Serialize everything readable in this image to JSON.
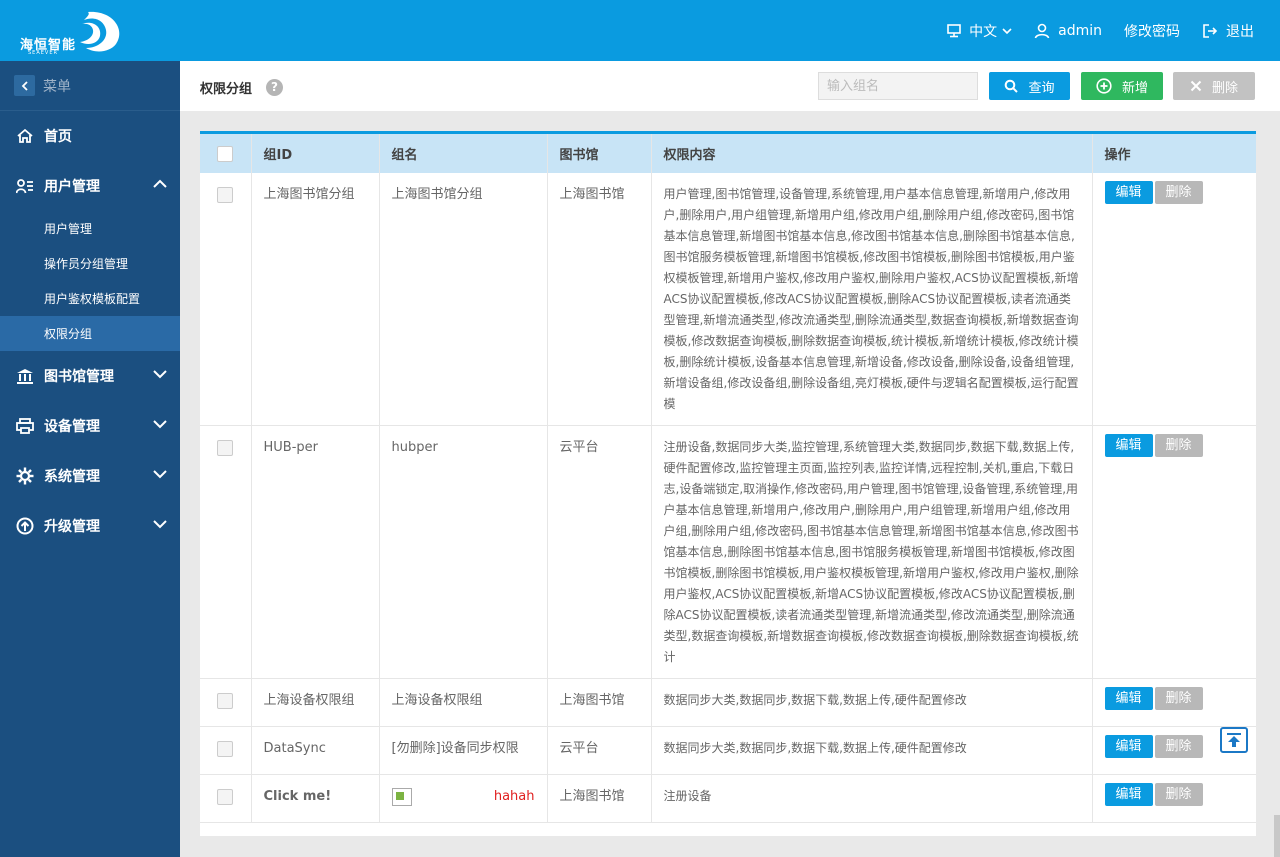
{
  "header": {
    "logo_text": "海恒智能",
    "logo_sub": "SEAEVER",
    "language": "中文",
    "username": "admin",
    "change_password": "修改密码",
    "logout": "退出"
  },
  "sidebar": {
    "menu_label": "菜单",
    "items": [
      {
        "label": "首页"
      },
      {
        "label": "用户管理"
      },
      {
        "label": "图书馆管理"
      },
      {
        "label": "设备管理"
      },
      {
        "label": "系统管理"
      },
      {
        "label": "升级管理"
      }
    ],
    "sub_items": [
      {
        "label": "用户管理"
      },
      {
        "label": "操作员分组管理"
      },
      {
        "label": "用户鉴权模板配置"
      },
      {
        "label": "权限分组"
      }
    ]
  },
  "toolbar": {
    "title": "权限分组",
    "help": "?",
    "search_placeholder": "输入组名",
    "query_label": "查询",
    "add_label": "新增",
    "delete_label": "删除"
  },
  "table": {
    "columns": [
      "组ID",
      "组名",
      "图书馆",
      "权限内容",
      "操作"
    ],
    "edit_label": "编辑",
    "delete_label": "删除",
    "rows": [
      {
        "id": "上海图书馆分组",
        "name": "上海图书馆分组",
        "library": "上海图书馆",
        "permissions": "用户管理,图书馆管理,设备管理,系统管理,用户基本信息管理,新增用户,修改用户,删除用户,用户组管理,新增用户组,修改用户组,删除用户组,修改密码,图书馆基本信息管理,新增图书馆基本信息,修改图书馆基本信息,删除图书馆基本信息,图书馆服务模板管理,新增图书馆模板,修改图书馆模板,删除图书馆模板,用户鉴权模板管理,新增用户鉴权,修改用户鉴权,删除用户鉴权,ACS协议配置模板,新增ACS协议配置模板,修改ACS协议配置模板,删除ACS协议配置模板,读者流通类型管理,新增流通类型,修改流通类型,删除流通类型,数据查询模板,新增数据查询模板,修改数据查询模板,删除数据查询模板,统计模板,新增统计模板,修改统计模板,删除统计模板,设备基本信息管理,新增设备,修改设备,删除设备,设备组管理,新增设备组,修改设备组,删除设备组,亮灯模板,硬件与逻辑名配置模板,运行配置模"
      },
      {
        "id": "HUB-per",
        "name": "hubper",
        "library": "云平台",
        "permissions": "注册设备,数据同步大类,监控管理,系统管理大类,数据同步,数据下载,数据上传,硬件配置修改,监控管理主页面,监控列表,监控详情,远程控制,关机,重启,下载日志,设备端锁定,取消操作,修改密码,用户管理,图书馆管理,设备管理,系统管理,用户基本信息管理,新增用户,修改用户,删除用户,用户组管理,新增用户组,修改用户组,删除用户组,修改密码,图书馆基本信息管理,新增图书馆基本信息,修改图书馆基本信息,删除图书馆基本信息,图书馆服务模板管理,新增图书馆模板,修改图书馆模板,删除图书馆模板,用户鉴权模板管理,新增用户鉴权,修改用户鉴权,删除用户鉴权,ACS协议配置模板,新增ACS协议配置模板,修改ACS协议配置模板,删除ACS协议配置模板,读者流通类型管理,新增流通类型,修改流通类型,删除流通类型,数据查询模板,新增数据查询模板,修改数据查询模板,删除数据查询模板,统计"
      },
      {
        "id": "上海设备权限组",
        "name": "上海设备权限组",
        "library": "上海图书馆",
        "permissions": "数据同步大类,数据同步,数据下载,数据上传,硬件配置修改"
      },
      {
        "id": "DataSync",
        "name": "[勿删除]设备同步权限",
        "library": "云平台",
        "permissions": "数据同步大类,数据同步,数据下载,数据上传,硬件配置修改"
      },
      {
        "id": "Click me!",
        "name": "hahah",
        "library": "上海图书馆",
        "permissions": "注册设备"
      }
    ]
  },
  "colors": {
    "primary": "#0a9be0",
    "sidebar": "#1b4f80",
    "success": "#2fb85f",
    "disabled": "#c2c2c2"
  }
}
